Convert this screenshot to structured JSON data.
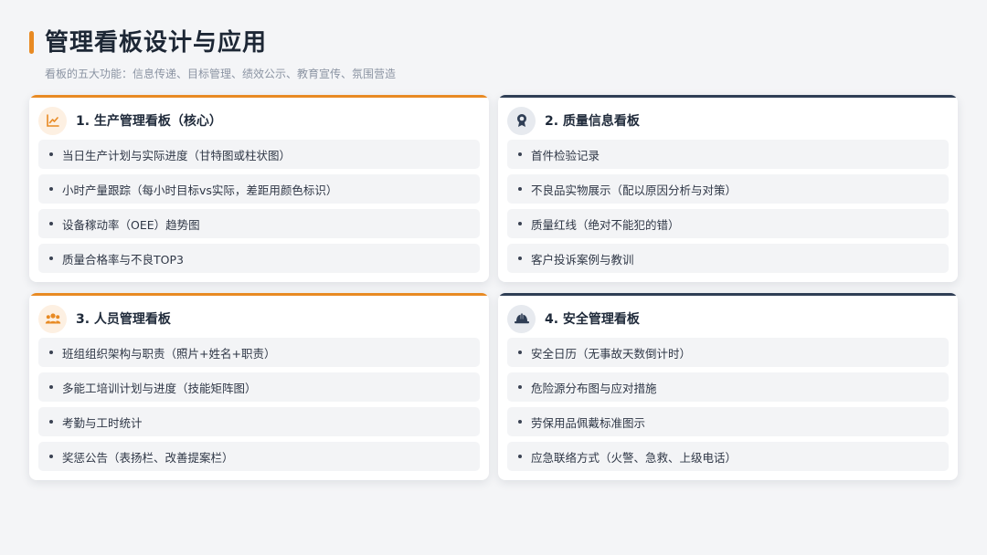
{
  "page": {
    "title": "管理看板设计与应用",
    "subtitle": "看板的五大功能：信息传递、目标管理、绩效公示、教育宣传、氛围营造"
  },
  "colors": {
    "accent_orange": "#e88a23",
    "accent_navy": "#2f3e55",
    "background": "#f4f5f7"
  },
  "cards": [
    {
      "title": "1. 生产管理看板（核心）",
      "icon": "line-chart-icon",
      "accent": "orange",
      "items": [
        "当日生产计划与实际进度（甘特图或柱状图）",
        "小时产量跟踪（每小时目标vs实际，差距用颜色标识）",
        "设备稼动率（OEE）趋势图",
        "质量合格率与不良TOP3"
      ]
    },
    {
      "title": "2. 质量信息看板",
      "icon": "award-ribbon-icon",
      "accent": "navy",
      "items": [
        "首件检验记录",
        "不良品实物展示（配以原因分析与对策）",
        "质量红线（绝对不能犯的错）",
        "客户投诉案例与教训"
      ]
    },
    {
      "title": "3. 人员管理看板",
      "icon": "people-group-icon",
      "accent": "orange",
      "items": [
        "班组组织架构与职责（照片+姓名+职责）",
        "多能工培训计划与进度（技能矩阵图）",
        "考勤与工时统计",
        "奖惩公告（表扬栏、改善提案栏）"
      ]
    },
    {
      "title": "4. 安全管理看板",
      "icon": "hard-hat-icon",
      "accent": "navy",
      "items": [
        "安全日历（无事故天数倒计时）",
        "危险源分布图与应对措施",
        "劳保用品佩戴标准图示",
        "应急联络方式（火警、急救、上级电话）"
      ]
    }
  ]
}
